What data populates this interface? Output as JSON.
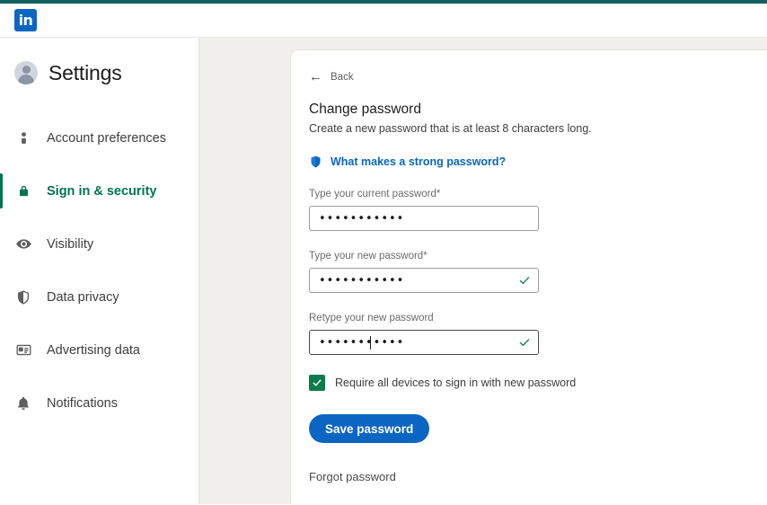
{
  "theme": {
    "top_strip_color": "#11625f",
    "brand_blue": "#0a66c2",
    "accent_green": "#01754f",
    "check_green": "#0a7b4b",
    "content_bg": "#f1f0ec"
  },
  "header": {
    "logo_text": "in",
    "logo_name": "linkedin-logo"
  },
  "sidebar": {
    "title": "Settings",
    "items": [
      {
        "label": "Account preferences",
        "icon": "person-icon",
        "active": false,
        "key": "account-preferences"
      },
      {
        "label": "Sign in & security",
        "icon": "lock-icon",
        "active": true,
        "key": "sign-in-security"
      },
      {
        "label": "Visibility",
        "icon": "eye-icon",
        "active": false,
        "key": "visibility"
      },
      {
        "label": "Data privacy",
        "icon": "shield-icon",
        "active": false,
        "key": "data-privacy"
      },
      {
        "label": "Advertising data",
        "icon": "ad-card-icon",
        "active": false,
        "key": "advertising-data"
      },
      {
        "label": "Notifications",
        "icon": "bell-icon",
        "active": false,
        "key": "notifications"
      }
    ]
  },
  "main": {
    "back_label": "Back",
    "title": "Change password",
    "subtitle": "Create a new password that is at least 8 characters long.",
    "strong_password_link": "What makes a strong password?",
    "fields": [
      {
        "label": "Type your current password*",
        "value": "•••••••••••",
        "placeholder": "",
        "valid": false,
        "focused": false,
        "key": "current-password"
      },
      {
        "label": "Type your new password*",
        "value": "•••••••••••",
        "placeholder": "",
        "valid": true,
        "focused": false,
        "key": "new-password"
      },
      {
        "label": "Retype your new password",
        "value": "•••••••••••",
        "placeholder": "",
        "valid": true,
        "focused": true,
        "key": "retype-new-password"
      }
    ],
    "require_devices_checkbox": {
      "label": "Require all devices to sign in with new password",
      "checked": true
    },
    "save_button": "Save password",
    "forgot_link": "Forgot password"
  }
}
